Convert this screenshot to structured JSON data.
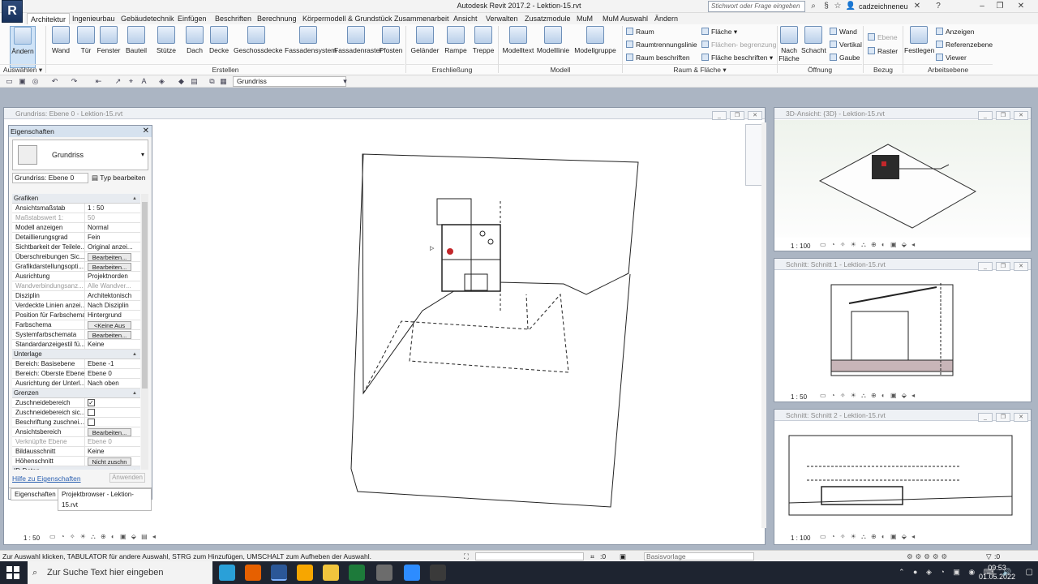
{
  "app": {
    "title": "Autodesk Revit 2017.2 -   Lektion-15.rvt",
    "logo": "R",
    "search_placeholder": "Stichwort oder Frage eingeben",
    "user": "cadzeichneneu"
  },
  "tabs": [
    "Architektur",
    "Ingenieurbau",
    "Gebäudetechnik",
    "Einfügen",
    "Beschriften",
    "Berechnung",
    "Körpermodell & Grundstück",
    "Zusammenarbeit",
    "Ansicht",
    "Verwalten",
    "Zusatzmodule",
    "MuM",
    "MuM Auswahl",
    "Ändern"
  ],
  "ribbon": {
    "select": {
      "label": "Ändern",
      "panel": "Auswählen ▾"
    },
    "build": {
      "items": [
        "Wand",
        "Tür",
        "Fenster",
        "Bauteil",
        "Stütze",
        "Dach",
        "Decke",
        "Geschossdecke",
        "Fassadensystem",
        "Fassadenraster",
        "Pfosten"
      ],
      "panel": "Erstellen"
    },
    "circulation": {
      "items": [
        "Geländer",
        "Rampe",
        "Treppe"
      ],
      "panel": "Erschließung"
    },
    "model": {
      "items": [
        "Modelltext",
        "Modelllinie",
        "Modellgruppe"
      ],
      "panel": "Modell"
    },
    "room": {
      "items": [
        "Raum",
        "Raumtrennungslinie",
        "Raum beschriften"
      ],
      "area": [
        "Fläche ▾",
        "Flächen- begrenzung",
        "Fläche beschriften ▾"
      ],
      "panel": "Raum & Fläche ▾"
    },
    "opening": {
      "big": [
        "Nach Fläche",
        "Schacht"
      ],
      "small": [
        "Wand",
        "Vertikal",
        "Gaube"
      ],
      "panel": "Öffnung"
    },
    "datum": {
      "items": [
        "Ebene",
        "Raster"
      ],
      "panel": "Bezug"
    },
    "workplane": {
      "big": "Festlegen",
      "small": [
        "Anzeigen",
        "Referenzebene",
        "Viewer"
      ],
      "panel": "Arbeitsebene"
    }
  },
  "qat": {
    "view": "Grundriss"
  },
  "views": {
    "main": {
      "title": "Grundriss: Ebene 0 - Lektion-15.rvt",
      "scale": "1 : 50"
    },
    "v3d": {
      "title": "3D-Ansicht: {3D} - Lektion-15.rvt",
      "scale": "1 : 100"
    },
    "s1": {
      "title": "Schnitt: Schnitt 1 - Lektion-15.rvt",
      "scale": "1 : 50"
    },
    "s2": {
      "title": "Schnitt: Schnitt 2 - Lektion-15.rvt",
      "scale": "1 : 100"
    }
  },
  "properties": {
    "title": "Eigenschaften",
    "type": "Grundriss",
    "instance": "Grundriss: Ebene 0",
    "edit_type": "Typ bearbeiten",
    "rows": [
      {
        "g": "Grafiken"
      },
      {
        "k": "Ansichtsmaßstab",
        "v": "1 : 50"
      },
      {
        "k": "Maßstabswert 1:",
        "v": "50",
        "dis": true
      },
      {
        "k": "Modell anzeigen",
        "v": "Normal"
      },
      {
        "k": "Detaillierungsgrad",
        "v": "Fein"
      },
      {
        "k": "Sichtbarkeit der Teilele...",
        "v": "Original anzei..."
      },
      {
        "k": "Überschreibungen Sic...",
        "b": "Bearbeiten..."
      },
      {
        "k": "Grafikdarstellungsopti...",
        "b": "Bearbeiten..."
      },
      {
        "k": "Ausrichtung",
        "v": "Projektnorden"
      },
      {
        "k": "Wandverbindungsanz...",
        "v": "Alle Wandver...",
        "dis": true
      },
      {
        "k": "Disziplin",
        "v": "Architektonisch"
      },
      {
        "k": "Verdeckte Linien anzei...",
        "v": "Nach Disziplin"
      },
      {
        "k": "Position für Farbschema",
        "v": "Hintergrund"
      },
      {
        "k": "Farbschema",
        "b": "<Keine Aus"
      },
      {
        "k": "Systemfarbschemata",
        "b": "Bearbeiten..."
      },
      {
        "k": "Standardanzeigestil fü...",
        "v": "Keine"
      },
      {
        "g": "Unterlage"
      },
      {
        "k": "Bereich: Basisebene",
        "v": "Ebene -1"
      },
      {
        "k": "Bereich: Oberste Ebene",
        "v": "Ebene 0"
      },
      {
        "k": "Ausrichtung der Unterl...",
        "v": "Nach oben"
      },
      {
        "g": "Grenzen"
      },
      {
        "k": "Zuschneidebereich",
        "c": "✓"
      },
      {
        "k": "Zuschneidebereich sic...",
        "c": ""
      },
      {
        "k": "Beschriftung zuschnei...",
        "c": ""
      },
      {
        "k": "Ansichtsbereich",
        "b": "Bearbeiten..."
      },
      {
        "k": "Verknüpfte Ebene",
        "v": "Ebene 0",
        "dis": true
      },
      {
        "k": "Bildausschnitt",
        "v": "Keine"
      },
      {
        "k": "Höhenschnitt",
        "b": "Nicht zuschn"
      },
      {
        "g": "ID-Daten"
      }
    ],
    "help": "Hilfe zu Eigenschaften",
    "apply": "Anwenden",
    "tab1": "Eigenschaften",
    "tab2": "Projektbrowser - Lektion-15.rvt"
  },
  "status": {
    "message": "Zur Auswahl klicken, TABULATOR für andere Auswahl, STRG zum Hinzufügen, UMSCHALT zum Aufheben der Auswahl.",
    "count": ":0",
    "model": "Basisvorlage",
    "filter": ":0"
  },
  "taskbar": {
    "search": "Zur Suche Text hier eingeben",
    "time": "09:53",
    "date": "01.05.2022"
  }
}
